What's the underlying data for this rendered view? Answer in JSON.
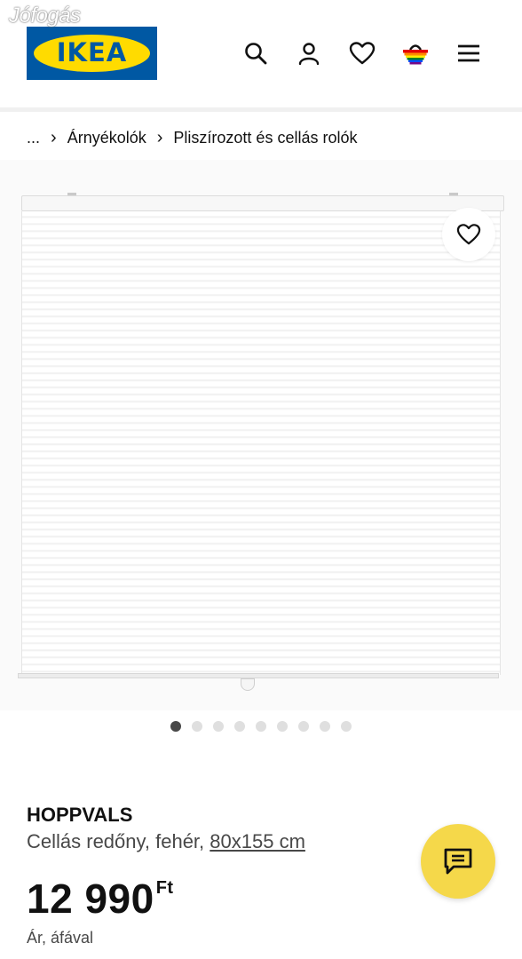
{
  "watermark": "Jófogás",
  "header": {
    "logo_text": "IKEA",
    "icons": [
      "search-icon",
      "user-icon",
      "heart-icon",
      "basket-icon",
      "menu-icon"
    ]
  },
  "breadcrumb": {
    "items": [
      "...",
      "Árnyékolók",
      "Pliszírozott és cellás rolók"
    ]
  },
  "gallery": {
    "dot_count": 9,
    "active_index": 0
  },
  "product": {
    "name": "HOPPVALS",
    "description": "Cellás redőny, fehér,",
    "size": "80x155 cm",
    "price": "12 990",
    "currency": "Ft",
    "vat_note": "Ár, áfával"
  },
  "colors": {
    "ikea_blue": "#0058a3",
    "ikea_yellow": "#ffdb00",
    "chat_button": "#f5d84a"
  }
}
